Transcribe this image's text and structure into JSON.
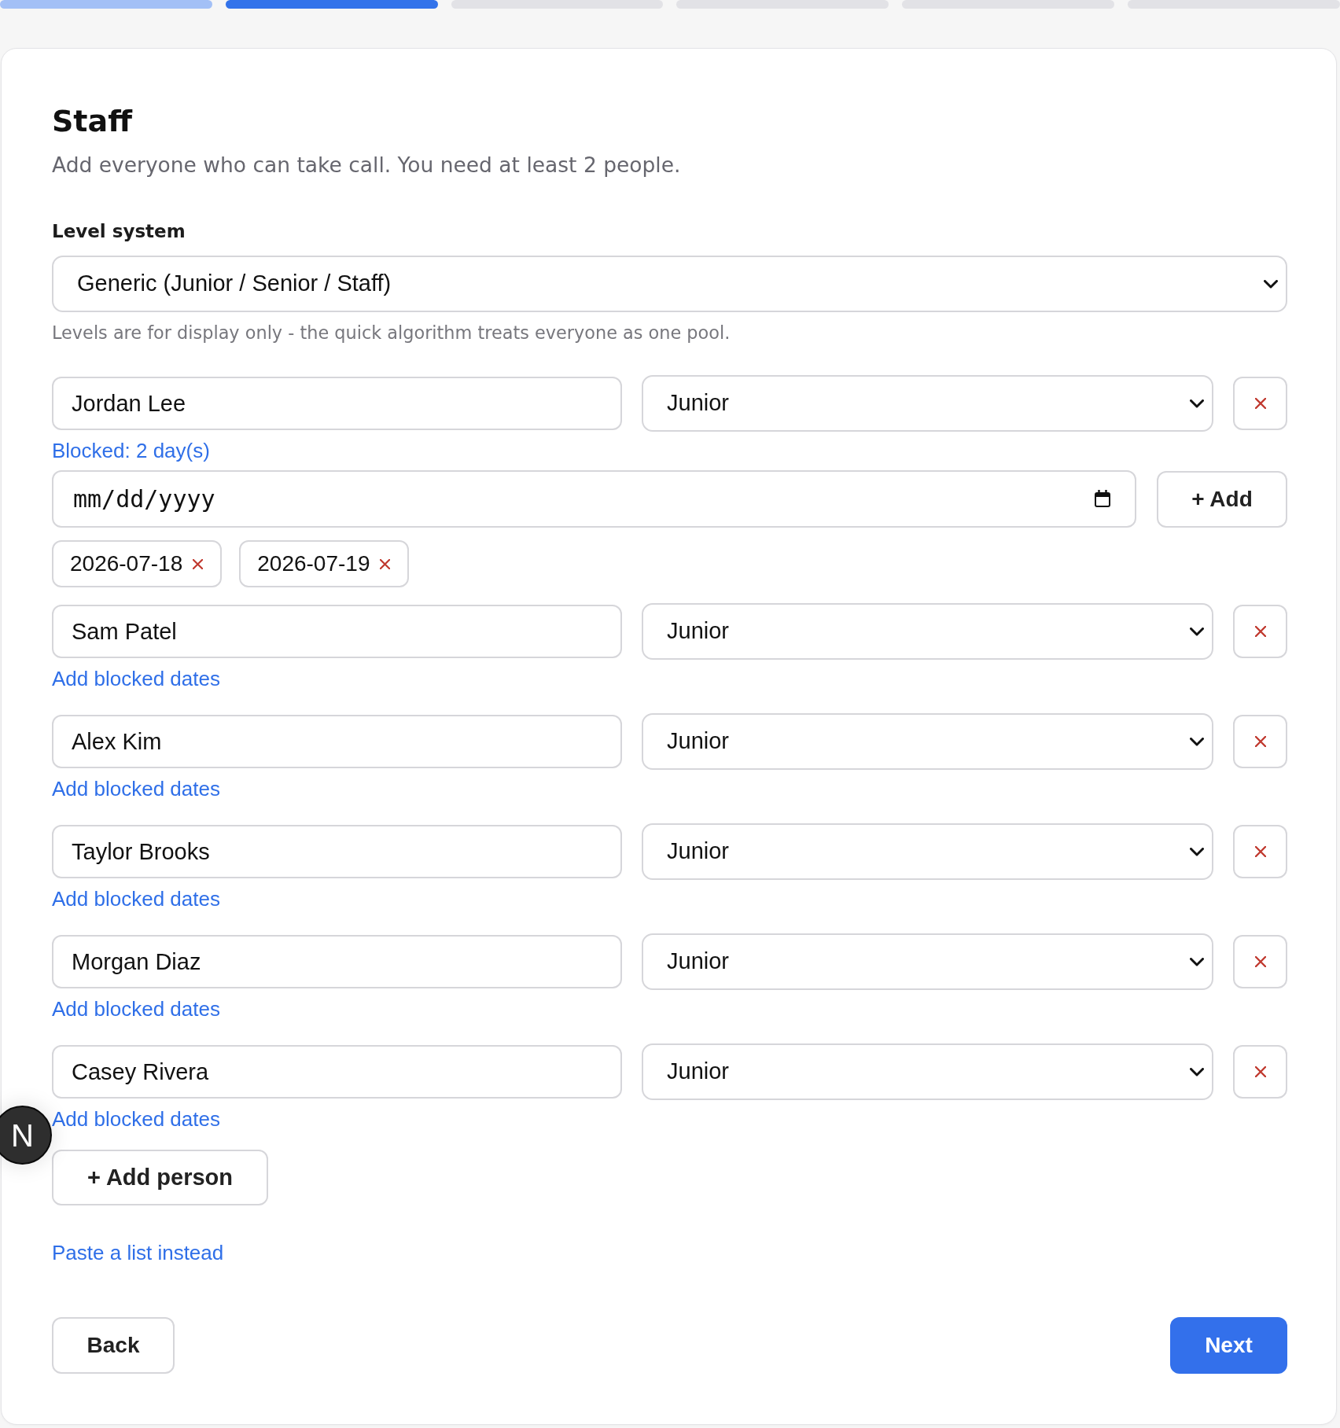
{
  "progress_steps": [
    {
      "complete": true,
      "selected": false
    },
    {
      "complete": false,
      "selected": true
    },
    {
      "complete": false,
      "selected": false
    },
    {
      "complete": false,
      "selected": false
    },
    {
      "complete": false,
      "selected": false
    },
    {
      "complete": false,
      "selected": false
    }
  ],
  "card": {
    "title": "Staff",
    "subtitle": "Add everyone who can take call. You need at least 2 people.",
    "level_system": {
      "label": "Level system",
      "value": "Generic (Junior / Senior / Staff)",
      "hint": "Levels are for display only - the quick algorithm treats everyone as one pool."
    },
    "people": [
      {
        "name": "Jordan Lee",
        "seniority": "Junior",
        "blocked_link": "Blocked: 2 day(s)",
        "date_field": {
          "placeholder": "mm/dd/yyyy"
        },
        "add_date_button": "+ Add",
        "blocked_dates": [
          "2026-07-18",
          "2026-07-19"
        ]
      },
      {
        "name": "Sam Patel",
        "seniority": "Junior",
        "blocked_link": "Add blocked dates"
      },
      {
        "name": "Alex Kim",
        "seniority": "Junior",
        "blocked_link": "Add blocked dates"
      },
      {
        "name": "Taylor Brooks",
        "seniority": "Junior",
        "blocked_link": "Add blocked dates"
      },
      {
        "name": "Morgan Diaz",
        "seniority": "Junior",
        "blocked_link": "Add blocked dates"
      },
      {
        "name": "Casey Rivera",
        "seniority": "Junior",
        "blocked_link": "Add blocked dates"
      }
    ],
    "add_person_button": "+ Add person",
    "paste_link": "Paste a list instead",
    "back_button": "Back",
    "next_button": "Next"
  },
  "dev_badge": {
    "label": "N"
  }
}
